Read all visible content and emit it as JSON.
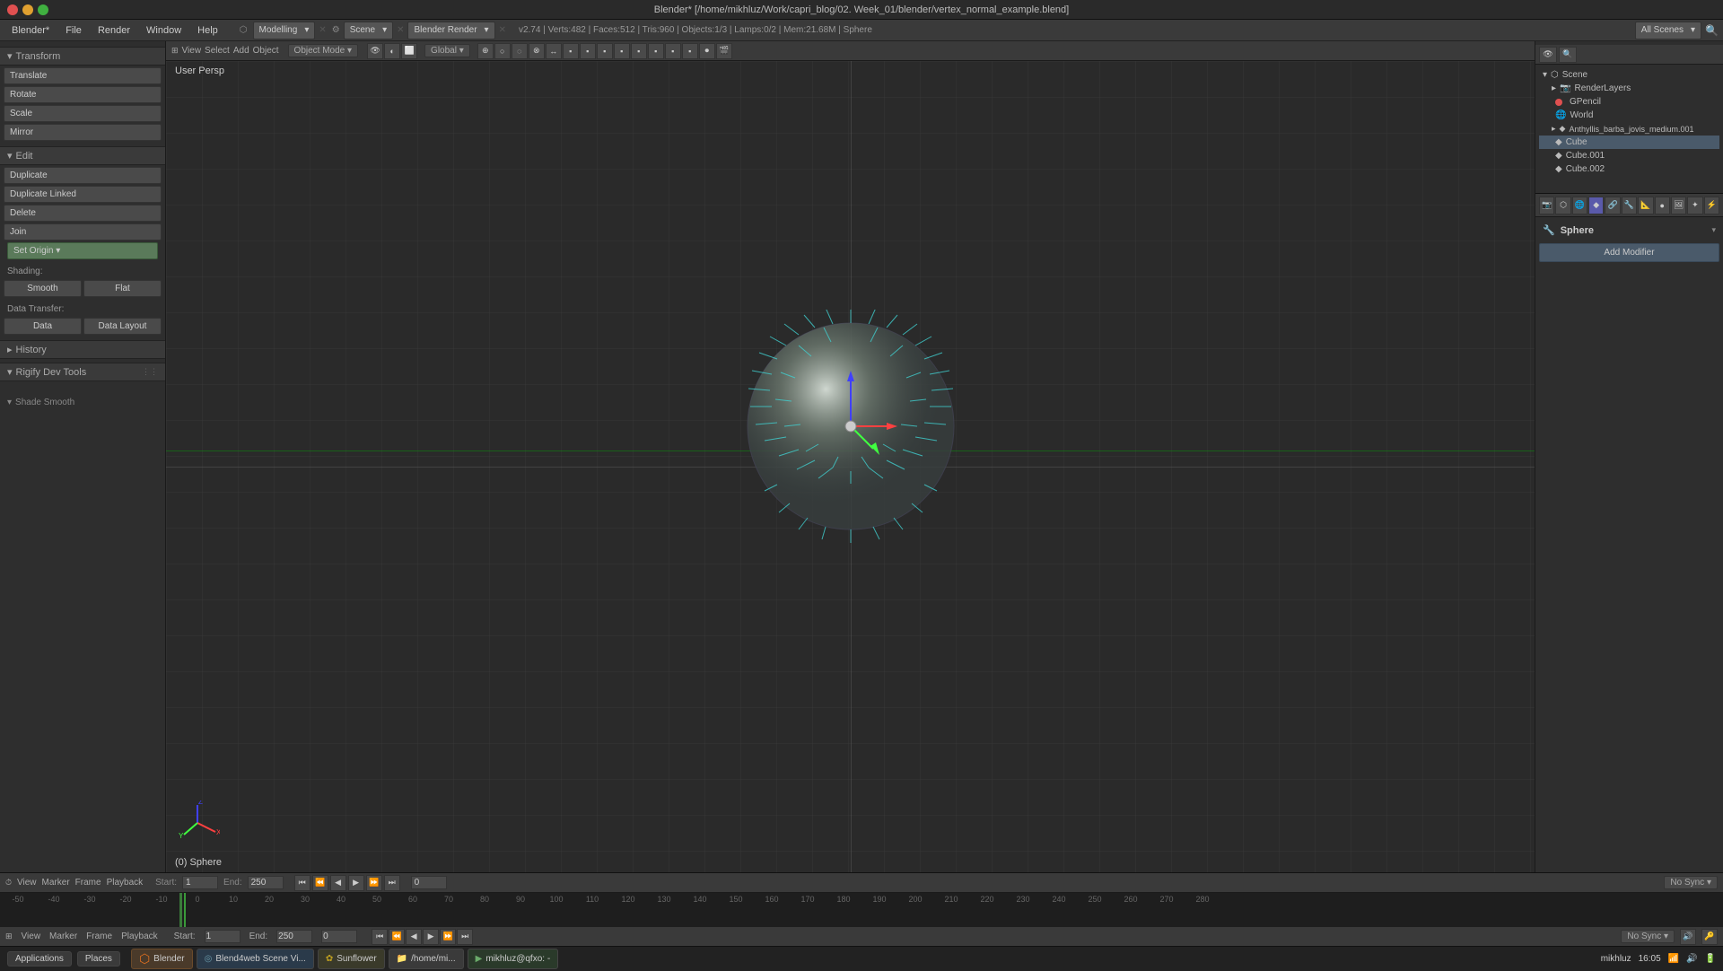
{
  "window": {
    "title": "Blender* [/home/mikhluz/Work/capri_blog/02. Week_01/blender/vertex_normal_example.blend]",
    "controls": {
      "close": "×",
      "minimize": "−",
      "maximize": "□"
    }
  },
  "menu": {
    "items": [
      "Blender*",
      "File",
      "Render",
      "Window",
      "Help"
    ]
  },
  "main_toolbar": {
    "mode": "Modelling",
    "scene": "Scene",
    "engine": "Blender Render",
    "status": "v2.74 | Verts:482 | Faces:512 | Tris:960 | Objects:1/3 | Lamps:0/2 | Mem:21.68M | Sphere",
    "scenes_label": "All Scenes"
  },
  "left_panel": {
    "transform_header": "Transform",
    "transform_btns": [
      "Translate",
      "Rotate",
      "Scale",
      "Mirror"
    ],
    "edit_header": "Edit",
    "edit_btns": [
      "Duplicate",
      "Duplicate Linked",
      "Delete",
      "Join"
    ],
    "set_origin": "Set Origin",
    "shading_label": "Shading:",
    "shading_btns": [
      "Smooth",
      "Flat"
    ],
    "data_transfer_label": "Data Transfer:",
    "data_btns": [
      "Data",
      "Data Layout"
    ],
    "history_header": "History",
    "rigify_header": "Rigify Dev Tools",
    "shade_smooth": "Shade Smooth"
  },
  "viewport": {
    "user_persp": "User Persp",
    "object_label": "(0) Sphere"
  },
  "viewport_toolbar": {
    "view": "View",
    "select": "Select",
    "add": "Add",
    "object": "Object",
    "mode": "Object Mode",
    "global": "Global",
    "icons": [
      "▶",
      "⟳",
      "◼",
      "🔍",
      "✏",
      "🖊",
      "⚡"
    ]
  },
  "scene_tree": {
    "scene_label": "Scene",
    "items": [
      {
        "name": "RenderLayers",
        "indent": 1,
        "icon": "camera"
      },
      {
        "name": "GPencil",
        "indent": 1,
        "icon": "pencil",
        "dot": "red"
      },
      {
        "name": "World",
        "indent": 1,
        "icon": "world"
      },
      {
        "name": "Anthyllis_barba_jovis_medium.001",
        "indent": 1,
        "icon": "object"
      },
      {
        "name": "Cube",
        "indent": 1,
        "icon": "object"
      },
      {
        "name": "Cube.001",
        "indent": 1,
        "icon": "object"
      },
      {
        "name": "Cube.002",
        "indent": 1,
        "icon": "object"
      }
    ]
  },
  "properties": {
    "object_name": "Sphere",
    "add_modifier": "Add Modifier",
    "toolbar_icons": [
      "⬡",
      "☽",
      "🔧",
      "⚡",
      "🔑",
      "📷",
      "🎭",
      "🔵",
      "⬜",
      "📦",
      "✦",
      "🌐"
    ]
  },
  "timeline": {
    "header_items": [
      "View",
      "Marker",
      "Frame",
      "Playback"
    ],
    "start": "1",
    "end": "250",
    "current": "0",
    "sync": "No Sync",
    "ticks": [
      "-50",
      "-40",
      "-30",
      "-20",
      "-10",
      "0",
      "10",
      "20",
      "30",
      "40",
      "50",
      "60",
      "70",
      "80",
      "90",
      "100",
      "110",
      "120",
      "130",
      "140",
      "150",
      "160",
      "170",
      "180",
      "190",
      "200",
      "210",
      "220",
      "230",
      "240",
      "250",
      "260",
      "270",
      "280"
    ]
  },
  "taskbar": {
    "apps": [
      {
        "name": "Applications",
        "color": "#555"
      },
      {
        "name": "Places",
        "color": "#555"
      },
      {
        "name": "Blender",
        "color": "#e07020"
      },
      {
        "name": "Blend4web Scene Vi...",
        "color": "#4a6a8a"
      },
      {
        "name": "Sunflower",
        "color": "#c0a020"
      },
      {
        "name": "/home/mi...",
        "color": "#4a4a6a"
      },
      {
        "name": "mikhluz@qfxo: -",
        "color": "#4a6a4a"
      }
    ],
    "time": "16:05",
    "user": "mikhluz"
  },
  "colors": {
    "bg_dark": "#1a1a1a",
    "bg_panel": "#2e2e2e",
    "bg_toolbar": "#3a3a3a",
    "btn_normal": "#4a4a4a",
    "btn_blue": "#4a5a6a",
    "accent_green": "#3a9a3a",
    "accent_orange": "#e07020",
    "x_axis": "#ff4040",
    "y_axis": "#40ff40",
    "z_axis": "#4040ff"
  }
}
